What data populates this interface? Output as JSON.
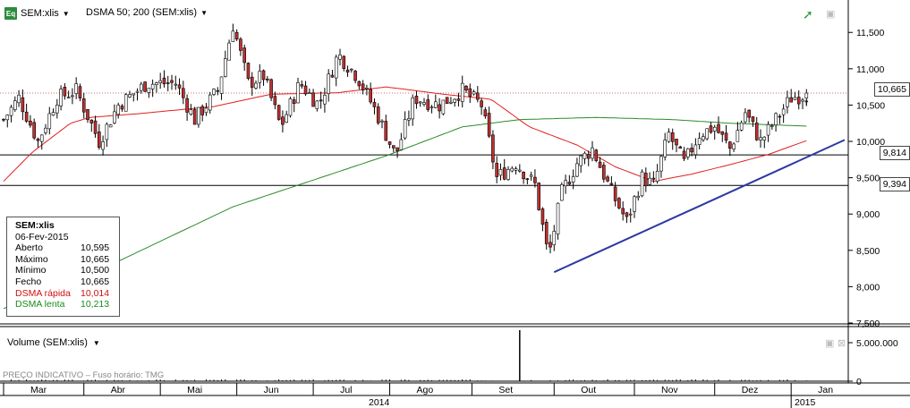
{
  "header": {
    "instrument_label": "SEM:xlis",
    "indicator_label": "DSMA 50; 200 (SEM:xlis)",
    "icon": "eq-icon"
  },
  "colors": {
    "price_up": "#2a8a2a",
    "price_down": "#000000",
    "dsma_fast": "#e02020",
    "dsma_slow": "#2a8c2a",
    "trendline": "#2b3aa0",
    "last_price_line": "#c04040"
  },
  "info_box": {
    "title": "SEM:xlis",
    "date": "06-Fev-2015",
    "rows": [
      {
        "label": "Aberto",
        "value": "10,595",
        "color": "#000000"
      },
      {
        "label": "Máximo",
        "value": "10,665",
        "color": "#000000"
      },
      {
        "label": "Mínimo",
        "value": "10,500",
        "color": "#000000"
      },
      {
        "label": "Fecho",
        "value": "10,665",
        "color": "#000000"
      },
      {
        "label": "DSMA rápida",
        "value": "10,014",
        "color": "#d01010"
      },
      {
        "label": "DSMA lenta",
        "value": "10,213",
        "color": "#1a8a1a"
      }
    ]
  },
  "price_tags": {
    "last": "10,665",
    "support_high": "9,814",
    "support_low": "9,394"
  },
  "volume_panel": {
    "label": "Volume (SEM:xlis)",
    "y_ticks": [
      "5.000.000",
      "0"
    ],
    "footnote": "PREÇO INDICATIVO – Fuso horário: TMG"
  },
  "chart_data": {
    "type": "candlestick",
    "y_axis": {
      "min": 7.5,
      "max": 11.7,
      "ticks": [
        "11,500",
        "11,000",
        "10,500",
        "10,000",
        "9,500",
        "9,000",
        "8,500",
        "8,000",
        "7,500"
      ],
      "tick_values": [
        11.5,
        11.0,
        10.5,
        10.0,
        9.5,
        9.0,
        8.5,
        8.0,
        7.5
      ]
    },
    "x_axis": {
      "months": [
        "Mar",
        "Abr",
        "Mai",
        "Jun",
        "Jul",
        "Ago",
        "Set",
        "Out",
        "Nov",
        "Dez",
        "Jan"
      ],
      "years": [
        "2014",
        "2015"
      ]
    },
    "price_keyframes": [
      {
        "t": 0,
        "v": 10.3
      },
      {
        "t": 8,
        "v": 10.6
      },
      {
        "t": 18,
        "v": 10.0
      },
      {
        "t": 28,
        "v": 10.6
      },
      {
        "t": 38,
        "v": 10.7
      },
      {
        "t": 50,
        "v": 10.0
      },
      {
        "t": 60,
        "v": 10.5
      },
      {
        "t": 75,
        "v": 10.8
      },
      {
        "t": 90,
        "v": 10.8
      },
      {
        "t": 100,
        "v": 10.3
      },
      {
        "t": 112,
        "v": 10.7
      },
      {
        "t": 120,
        "v": 11.6
      },
      {
        "t": 128,
        "v": 10.8
      },
      {
        "t": 136,
        "v": 10.9
      },
      {
        "t": 145,
        "v": 10.2
      },
      {
        "t": 155,
        "v": 10.8
      },
      {
        "t": 165,
        "v": 10.5
      },
      {
        "t": 175,
        "v": 11.2
      },
      {
        "t": 185,
        "v": 10.9
      },
      {
        "t": 195,
        "v": 10.4
      },
      {
        "t": 205,
        "v": 9.8
      },
      {
        "t": 215,
        "v": 10.6
      },
      {
        "t": 228,
        "v": 10.5
      },
      {
        "t": 240,
        "v": 10.7
      },
      {
        "t": 250,
        "v": 10.5
      },
      {
        "t": 258,
        "v": 9.5
      },
      {
        "t": 268,
        "v": 9.7
      },
      {
        "t": 278,
        "v": 9.4
      },
      {
        "t": 285,
        "v": 8.4
      },
      {
        "t": 292,
        "v": 9.3
      },
      {
        "t": 300,
        "v": 9.7
      },
      {
        "t": 308,
        "v": 9.9
      },
      {
        "t": 318,
        "v": 9.3
      },
      {
        "t": 326,
        "v": 8.9
      },
      {
        "t": 334,
        "v": 9.5
      },
      {
        "t": 340,
        "v": 9.4
      },
      {
        "t": 348,
        "v": 10.1
      },
      {
        "t": 356,
        "v": 9.7
      },
      {
        "t": 364,
        "v": 10.1
      },
      {
        "t": 372,
        "v": 10.2
      },
      {
        "t": 380,
        "v": 9.9
      },
      {
        "t": 388,
        "v": 10.4
      },
      {
        "t": 396,
        "v": 10.0
      },
      {
        "t": 404,
        "v": 10.3
      },
      {
        "t": 412,
        "v": 10.6
      },
      {
        "t": 420,
        "v": 10.65
      }
    ],
    "dsma_fast_keyframes": [
      {
        "t": 0,
        "v": 9.45
      },
      {
        "t": 15,
        "v": 9.85
      },
      {
        "t": 35,
        "v": 10.25
      },
      {
        "t": 45,
        "v": 10.33
      },
      {
        "t": 70,
        "v": 10.38
      },
      {
        "t": 110,
        "v": 10.48
      },
      {
        "t": 140,
        "v": 10.65
      },
      {
        "t": 175,
        "v": 10.67
      },
      {
        "t": 200,
        "v": 10.75
      },
      {
        "t": 230,
        "v": 10.65
      },
      {
        "t": 255,
        "v": 10.58
      },
      {
        "t": 275,
        "v": 10.2
      },
      {
        "t": 300,
        "v": 9.95
      },
      {
        "t": 320,
        "v": 9.65
      },
      {
        "t": 340,
        "v": 9.45
      },
      {
        "t": 360,
        "v": 9.55
      },
      {
        "t": 380,
        "v": 9.68
      },
      {
        "t": 400,
        "v": 9.82
      },
      {
        "t": 420,
        "v": 10.01
      }
    ],
    "dsma_slow_keyframes": [
      {
        "t": 0,
        "v": 7.7
      },
      {
        "t": 40,
        "v": 8.1
      },
      {
        "t": 80,
        "v": 8.6
      },
      {
        "t": 120,
        "v": 9.1
      },
      {
        "t": 160,
        "v": 9.45
      },
      {
        "t": 200,
        "v": 9.8
      },
      {
        "t": 240,
        "v": 10.2
      },
      {
        "t": 270,
        "v": 10.3
      },
      {
        "t": 310,
        "v": 10.33
      },
      {
        "t": 350,
        "v": 10.3
      },
      {
        "t": 380,
        "v": 10.25
      },
      {
        "t": 420,
        "v": 10.21
      }
    ],
    "horizontal_lines": [
      9.814,
      9.394
    ],
    "last_price": 10.665,
    "trendline": {
      "from": {
        "t": 288,
        "v": 8.2
      },
      "to": {
        "t": 440,
        "v": 10.02
      }
    }
  }
}
